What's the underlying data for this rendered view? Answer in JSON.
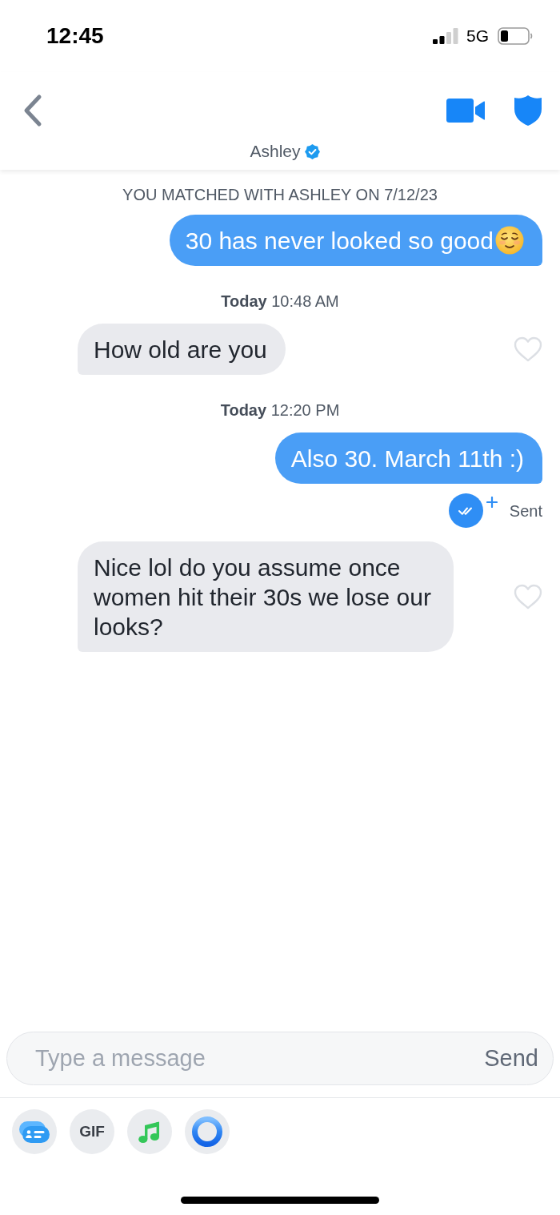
{
  "status_bar": {
    "time": "12:45",
    "network": "5G"
  },
  "header": {
    "name": "Ashley",
    "verified": true
  },
  "conversation": [
    {
      "kind": "system",
      "text": "YOU MATCHED WITH ASHLEY ON 7/12/23"
    },
    {
      "kind": "outgoing",
      "text": "30 has never looked so good",
      "emoji": true
    },
    {
      "kind": "timestamp",
      "text": "**Today** 10:48 AM"
    },
    {
      "kind": "incoming",
      "text": "How old are you",
      "liked": false
    },
    {
      "kind": "timestamp",
      "text": "**Today** 12:20 PM"
    },
    {
      "kind": "outgoing",
      "text": "Also 30. March 11th :)",
      "status": "Sent",
      "read": true
    },
    {
      "kind": "incoming",
      "text": "Nice lol do you assume once women hit their 30s we lose our looks?",
      "liked": false
    }
  ],
  "composer": {
    "placeholder": "Type a message",
    "send_label": "Send"
  },
  "toolbar": [
    {
      "kind": "card"
    },
    {
      "kind": "text",
      "label": "GIF"
    },
    {
      "kind": "note"
    },
    {
      "kind": "ring"
    }
  ]
}
